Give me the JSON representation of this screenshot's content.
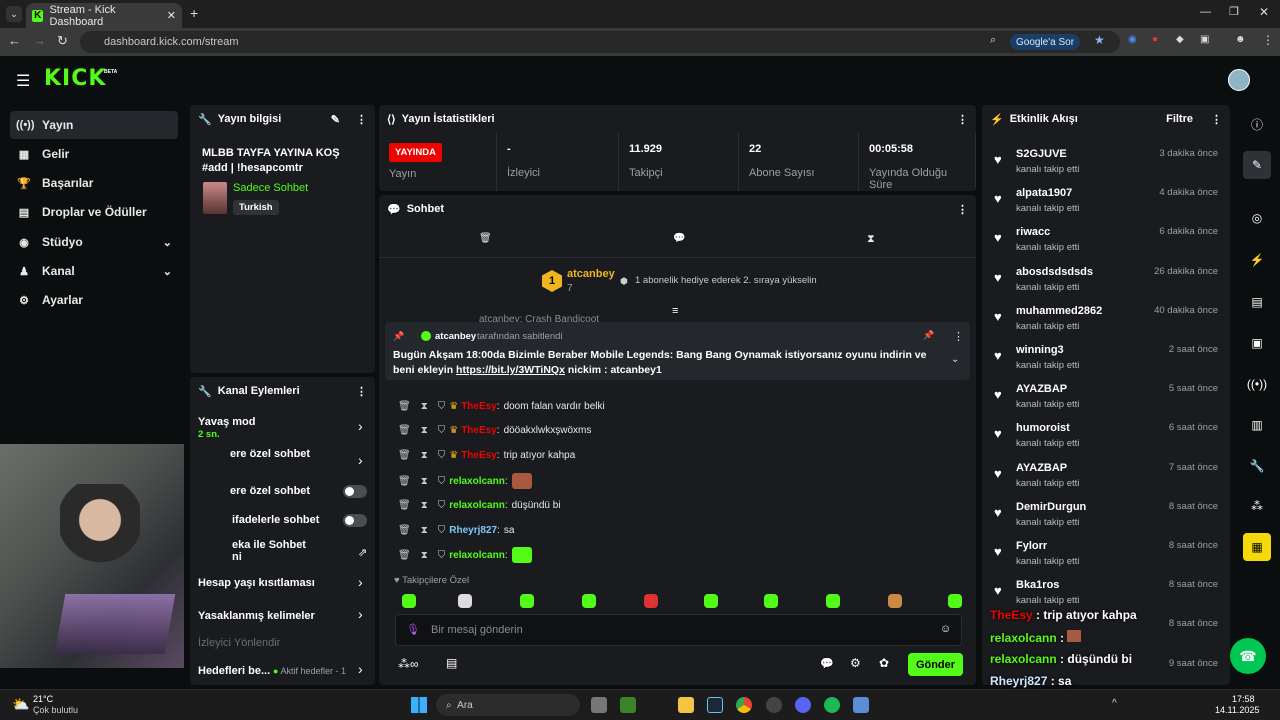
{
  "browser": {
    "tab_title": "Stream - Kick Dashboard",
    "url": "dashboard.kick.com/stream",
    "ask_google": "Google'a Sor"
  },
  "header": {
    "logo": "KICK",
    "beta": "BETA"
  },
  "sidebar": {
    "items": [
      {
        "label": "Yayın",
        "icon": "broadcast-icon"
      },
      {
        "label": "Gelir",
        "icon": "chart-icon"
      },
      {
        "label": "Başarılar",
        "icon": "trophy-icon"
      },
      {
        "label": "Droplar ve Ödüller",
        "icon": "gift-icon"
      },
      {
        "label": "Stüdyo",
        "icon": "studio-icon"
      },
      {
        "label": "Kanal",
        "icon": "channel-icon"
      },
      {
        "label": "Ayarlar",
        "icon": "gear-icon"
      }
    ]
  },
  "stream_info": {
    "header": "Yayın bilgisi",
    "title": "MLBB TAYFA YAYINA KOŞ #add | !hesapcomtr",
    "category": "Sadece Sohbet",
    "tag": "Turkish"
  },
  "stats": {
    "header": "Yayın İstatistikleri",
    "live_badge": "YAYINDA",
    "items": [
      {
        "value": "",
        "label": "Yayın"
      },
      {
        "value": "-",
        "label": "İzleyici"
      },
      {
        "value": "11.929",
        "label": "Takipçi"
      },
      {
        "value": "22",
        "label": "Abone Sayısı"
      },
      {
        "value": "00:05:58",
        "label": "Yayında Olduğu Süre"
      }
    ]
  },
  "chat": {
    "header": "Sohbet",
    "leader_name": "atcanbey",
    "leader_rank": "1",
    "leader_count": "7",
    "gift_hint": "1 abonelik hediye ederek 2. sıraya yükselin",
    "partial_top": "atcanbey: Crash Bandicoot",
    "pinned_by": "atcanbey",
    "pinned_suffix": "tarafından sabitlendi",
    "pinned_text": "Bugün Akşam 18:00da Bizimle Beraber Mobile Legends: Bang Bang Oynamak istiyorsanız oyunu indirin ve beni ekleyin",
    "pinned_link": "https://bit.ly/3WTiNQx",
    "pinned_tail": "nickim : atcanbey1",
    "messages": [
      {
        "user": "TheEsy",
        "text": "doom falan vardır belki",
        "color": "red"
      },
      {
        "user": "TheEsy",
        "text": "dööakxlwkxşwöxms",
        "color": "red"
      },
      {
        "user": "TheEsy",
        "text": "trip atıyor kahpa",
        "color": "red"
      },
      {
        "user": "relaxolcann",
        "text": "",
        "color": "green"
      },
      {
        "user": "relaxolcann",
        "text": "düşündü bi",
        "color": "green"
      },
      {
        "user": "Rheyrj827",
        "text": "sa",
        "color": "blue"
      },
      {
        "user": "relaxolcann",
        "text": "",
        "color": "green"
      }
    ],
    "followers_only": "Takipçilere Özel",
    "input_placeholder": "Bir mesaj gönderin",
    "send": "Gönder"
  },
  "channel_actions": {
    "header": "Kanal Eylemleri",
    "slow_mode": "Yavaş mod",
    "slow_mode_value": "2 sn.",
    "followers_chat": "ere özel sohbet",
    "subs_chat": "ere özel sohbet",
    "emote_chat": "ifadelerle sohbet",
    "ai_mod": "eka ile Sohbet",
    "ai_mod2": "ni",
    "account_age": "Hesap yaşı kısıtlaması",
    "banned_words": "Yasaklanmış kelimeler",
    "viewer_guide": "İzleyici Yönlendir",
    "goals": "Hedefleri be...",
    "active_goals": "Aktif hedefler - 1"
  },
  "activity": {
    "header": "Etkinlik Akışı",
    "filter": "Filtre",
    "items": [
      {
        "name": "S2GJUVE",
        "sub": "kanalı takip etti",
        "time": "3 dakika önce"
      },
      {
        "name": "alpata1907",
        "sub": "kanalı takip etti",
        "time": "4 dakika önce"
      },
      {
        "name": "riwacc",
        "sub": "kanalı takip etti",
        "time": "6 dakika önce"
      },
      {
        "name": "abosdsdsdsds",
        "sub": "kanalı takip etti",
        "time": "26 dakika önce"
      },
      {
        "name": "muhammed2862",
        "sub": "kanalı takip etti",
        "time": "40 dakika önce"
      },
      {
        "name": "winning3",
        "sub": "kanalı takip etti",
        "time": "2 saat önce"
      },
      {
        "name": "AYAZBAP",
        "sub": "kanalı takip etti",
        "time": "5 saat önce"
      },
      {
        "name": "humoroist",
        "sub": "kanalı takip etti",
        "time": "6 saat önce"
      },
      {
        "name": "AYAZBAP",
        "sub": "kanalı takip etti",
        "time": "7 saat önce"
      },
      {
        "name": "DemirDurgun",
        "sub": "kanalı takip etti",
        "time": "8 saat önce"
      },
      {
        "name": "Fylorr",
        "sub": "kanalı takip etti",
        "time": "8 saat önce"
      },
      {
        "name": "Bka1ros",
        "sub": "kanalı takip etti",
        "time": "8 saat önce"
      },
      {
        "name": "",
        "sub": "",
        "time": "8 saat önce"
      },
      {
        "name": "",
        "sub": "",
        "time": "9 saat önce"
      }
    ]
  },
  "overlay": {
    "lines": [
      {
        "user": "TheEsy",
        "text": "trip atıyor kahpa"
      },
      {
        "user": "relaxolcann",
        "text": ""
      },
      {
        "user": "relaxolcann",
        "text": "düşündü bi"
      },
      {
        "user": "Rheyrj827",
        "text": "sa"
      },
      {
        "user": "relaxolcann",
        "text": ""
      }
    ]
  },
  "taskbar": {
    "weather_temp": "21°C",
    "weather_desc": "Çok bulutlu",
    "search": "Ara",
    "time": "17:58",
    "date": "14.11.2025"
  },
  "colors": {
    "brand": "#53fc18",
    "live": "#eb0400"
  }
}
